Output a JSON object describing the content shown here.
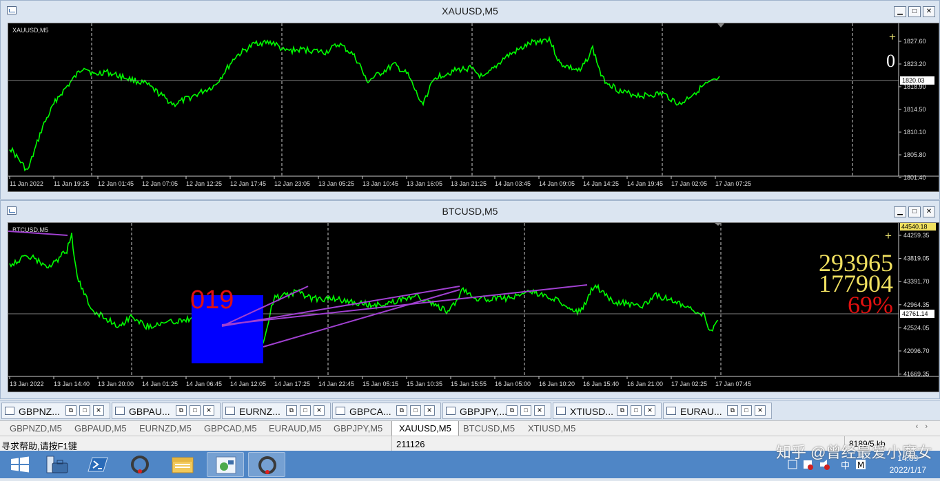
{
  "windows": [
    {
      "title": "XAUUSD,M5",
      "chart_label": "XAUUSD,M5",
      "big_value": "0",
      "price_ticks": [
        "1827.60",
        "1823.20",
        "1818.90",
        "1814.50",
        "1810.10",
        "1805.80",
        "1801.40"
      ],
      "current_price": "1820.03",
      "time_ticks": [
        "11 Jan 2022",
        "11 Jan 19:25",
        "12 Jan 01:45",
        "12 Jan 07:05",
        "12 Jan 12:25",
        "12 Jan 17:45",
        "12 Jan 23:05",
        "13 Jan 05:25",
        "13 Jan 10:45",
        "13 Jan 16:05",
        "13 Jan 21:25",
        "14 Jan 03:45",
        "14 Jan 09:05",
        "14 Jan 14:25",
        "14 Jan 19:45",
        "17 Jan 02:05",
        "17 Jan 07:25"
      ]
    },
    {
      "title": "BTCUSD,M5",
      "chart_label": "BTCUSD,M5",
      "overlay_number": "019",
      "stat_1": "293965",
      "stat_2": "177904",
      "stat_pct": "69%",
      "price_ticks": [
        "44259.35",
        "43819.05",
        "43391.70",
        "42964.35",
        "42524.05",
        "42096.70",
        "41669.35"
      ],
      "top_price": "44540.18",
      "current_price": "42761.14",
      "time_ticks": [
        "13 Jan 2022",
        "13 Jan 14:40",
        "13 Jan 20:00",
        "14 Jan 01:25",
        "14 Jan 06:45",
        "14 Jan 12:05",
        "14 Jan 17:25",
        "14 Jan 22:45",
        "15 Jan 05:15",
        "15 Jan 10:35",
        "15 Jan 15:55",
        "16 Jan 05:00",
        "16 Jan 10:20",
        "16 Jan 15:40",
        "16 Jan 21:00",
        "17 Jan 02:25",
        "17 Jan 07:45"
      ]
    }
  ],
  "chart_tabs": [
    "GBPNZ...",
    "GBPAU...",
    "EURNZ...",
    "GBPCA...",
    "GBPJPY,...",
    "XTIUSD...",
    "EURAU..."
  ],
  "symbol_tabs": [
    "GBPNZD,M5",
    "GBPAUD,M5",
    "EURNZD,M5",
    "GBPCAD,M5",
    "EURAUD,M5",
    "GBPJPY,M5",
    "XAUUSD,M5",
    "BTCUSD,M5",
    "XTIUSD,M5"
  ],
  "active_symbol_tab": "XAUUSD,M5",
  "status": {
    "help_text": "寻求帮助,请按F1键",
    "bars": "211126",
    "connection": "8189/5 kb"
  },
  "clock": {
    "time": "14:09",
    "date": "2022/1/17"
  },
  "watermark": "知乎 @曾经最爱小魔女",
  "colors": {
    "candle": "#00ff00",
    "trendline": "#a040d0",
    "box": "#0000ff",
    "red": "#e01010",
    "yellow": "#f0e060"
  }
}
